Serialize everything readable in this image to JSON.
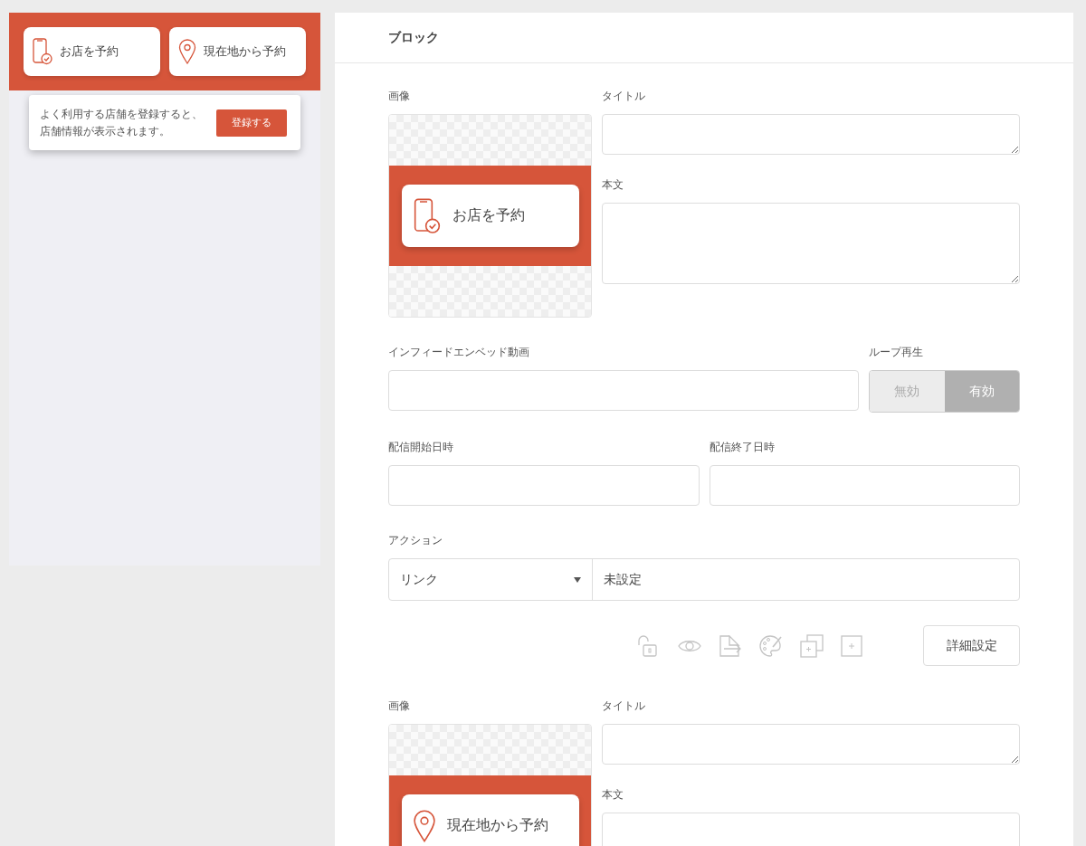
{
  "preview": {
    "buttons": [
      {
        "label": "お店を予約",
        "kind": "phone"
      },
      {
        "label": "現在地から予約",
        "kind": "pin"
      }
    ],
    "notice": {
      "text": "よく利用する店舗を登録すると、店舗情報が表示されます。",
      "button": "登録する"
    }
  },
  "editor": {
    "header": "ブロック",
    "blocks": [
      {
        "image_label": "画像",
        "image": {
          "label": "お店を予約",
          "kind": "phone"
        },
        "title_label": "タイトル",
        "body_label": "本文",
        "video_label": "インフィードエンベッド動画",
        "loop_label": "ループ再生",
        "loop_options": [
          {
            "label": "無効",
            "selected": false
          },
          {
            "label": "有効",
            "selected": true
          }
        ],
        "start_label": "配信開始日時",
        "end_label": "配信終了日時",
        "action_label": "アクション",
        "action_type": "リンク",
        "action_value": "未設定",
        "detail_button": "詳細設定"
      },
      {
        "image_label": "画像",
        "image": {
          "label": "現在地から予約",
          "kind": "pin"
        },
        "title_label": "タイトル",
        "body_label": "本文"
      }
    ]
  }
}
